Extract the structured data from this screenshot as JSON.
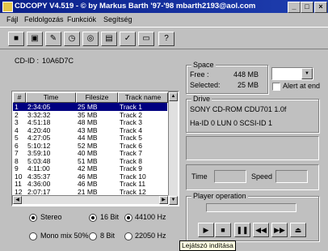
{
  "window": {
    "title": "CDCOPY  V4.519 - © by Markus Barth '97-'98 mbarth2193@aol.com"
  },
  "menu": [
    "Fájl",
    "Feldolgozás",
    "Funkciók",
    "Segítség"
  ],
  "toolbar_icons": [
    "stop-icon",
    "save-icon",
    "edit-icon",
    "clock-icon",
    "cd-icon",
    "document-icon",
    "checklist-icon",
    "folder-icon",
    "help-icon"
  ],
  "cdid": {
    "label": "CD-ID :",
    "value": "10A6D7C"
  },
  "track_list": {
    "columns": [
      "#",
      "Time",
      "Filesize",
      "Track name"
    ],
    "rows": [
      [
        "1",
        "2:34:05",
        "25 MB",
        "Track  1"
      ],
      [
        "2",
        "3:32:32",
        "35 MB",
        "Track  2"
      ],
      [
        "3",
        "4:51:18",
        "48 MB",
        "Track  3"
      ],
      [
        "4",
        "4:20:40",
        "43 MB",
        "Track  4"
      ],
      [
        "5",
        "4:27:05",
        "44 MB",
        "Track  5"
      ],
      [
        "6",
        "5:10:12",
        "52 MB",
        "Track  6"
      ],
      [
        "7",
        "3:59:10",
        "40 MB",
        "Track  7"
      ],
      [
        "8",
        "5:03:48",
        "51 MB",
        "Track  8"
      ],
      [
        "9",
        "4:11:00",
        "42 MB",
        "Track  9"
      ],
      [
        "10",
        "4:35:37",
        "46 MB",
        "Track 10"
      ],
      [
        "11",
        "4:36:00",
        "46 MB",
        "Track 11"
      ],
      [
        "12",
        "2:07:17",
        "21 MB",
        "Track 12"
      ]
    ],
    "selected_index": 0
  },
  "format": {
    "stereo": "Stereo",
    "mono": "Mono mix 50%",
    "bit16": "16 Bit",
    "bit8": "8 Bit",
    "hz44": "44100 Hz",
    "hz22": "22050 Hz"
  },
  "space": {
    "title": "Space",
    "free_label": "Free :",
    "free_value": "448 MB",
    "selected_label": "Selected:",
    "selected_value": "25 MB",
    "alert_label": "Alert at end"
  },
  "drive": {
    "title": "Drive",
    "line1": "SONY    CD-ROM CDU701   1.0f",
    "line2": "Ha-ID 0 LUN 0 SCSI-ID 1"
  },
  "time_label": "Time",
  "speed_label": "Speed",
  "player": {
    "title": "Player operation",
    "buttons": [
      "play-icon",
      "stop-icon",
      "pause-icon",
      "previous-icon",
      "next-icon",
      "eject-icon"
    ],
    "tooltip": "Lejátszó indítása"
  },
  "colors": {
    "titlebar": "#0a1f8a",
    "selection": "#000080",
    "tooltip_bg": "#ffffe1"
  }
}
